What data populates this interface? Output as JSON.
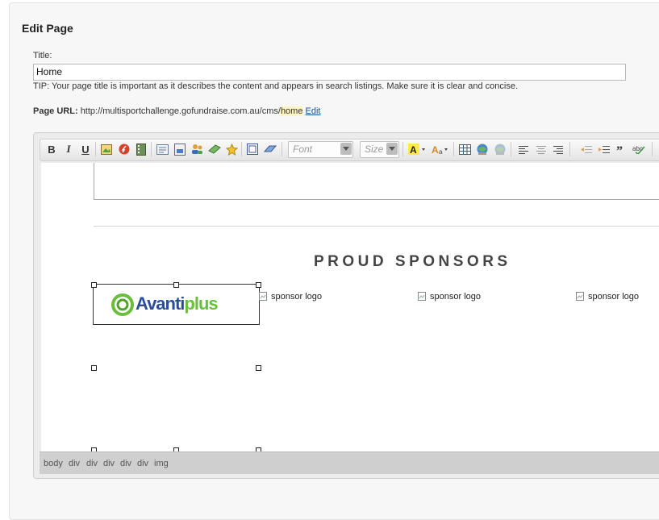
{
  "header": {
    "title": "Edit Page"
  },
  "form": {
    "title_label": "Title:",
    "title_value": "Home",
    "tip": "TIP: Your page title is important as it describes the content and appears in search listings. Make sure it is clear and concise.",
    "page_url_label": "Page URL:",
    "page_url_base": "http://multisportchallenge.gofundraise.com.au/cms/",
    "page_url_slug": "home",
    "edit_link": "Edit"
  },
  "toolbar": {
    "bold": "B",
    "italic": "I",
    "underline": "U",
    "font_placeholder": "Font",
    "size_placeholder": "Size",
    "buttons": [
      "bold-icon",
      "italic-icon",
      "underline-icon",
      "image-icon",
      "flash-icon",
      "media-icon",
      "form-icon",
      "template-icon",
      "users-icon",
      "money-icon",
      "award-icon",
      "fullscreen-icon",
      "eraser-icon",
      "text-color-icon",
      "font-size-icon",
      "table-icon",
      "link-icon",
      "unlink-icon",
      "align-left-icon",
      "align-center-icon",
      "align-right-icon",
      "outdent-icon",
      "indent-icon",
      "blockquote-icon",
      "spellcheck-icon"
    ]
  },
  "content": {
    "sponsors_heading": "PROUD SPONSORS",
    "logo_text_main": "Avanti",
    "logo_text_accent": "plus",
    "sponsor_alt_1": "sponsor logo",
    "sponsor_alt_2": "sponsor logo",
    "sponsor_alt_3": "sponsor logo"
  },
  "statusbar": {
    "path": [
      "body",
      "div",
      "div",
      "div",
      "div",
      "div",
      "img"
    ]
  },
  "colors": {
    "logo_blue": "#2b4d9a",
    "logo_green": "#6abf3a",
    "url_highlight": "#fff3c4",
    "link": "#1a4fa3"
  }
}
